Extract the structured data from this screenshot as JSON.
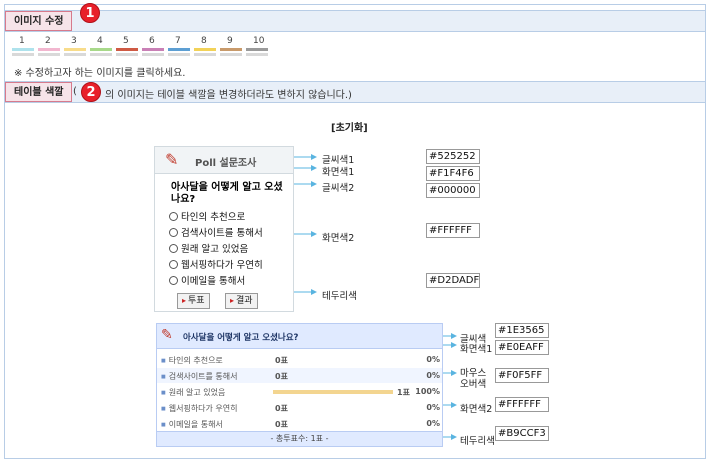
{
  "section1": {
    "title": "이미지 수정",
    "badge": "1",
    "note": "※ 수정하고자 하는 이미지를 클릭하세요."
  },
  "swatches": [
    {
      "num": "1",
      "c": "#aee2ec"
    },
    {
      "num": "2",
      "c": "#f2b6cf"
    },
    {
      "num": "3",
      "c": "#f8dc8a"
    },
    {
      "num": "4",
      "c": "#a8d98a"
    },
    {
      "num": "5",
      "c": "#cf5a44"
    },
    {
      "num": "6",
      "c": "#c980b6"
    },
    {
      "num": "7",
      "c": "#5d9fd3"
    },
    {
      "num": "8",
      "c": "#f2d258"
    },
    {
      "num": "9",
      "c": "#c89a6b"
    },
    {
      "num": "10",
      "c": "#9a9a9a"
    }
  ],
  "section2": {
    "title": "테이블 색깔",
    "badge": "2",
    "note_prefix": "(",
    "note": "의 이미지는 테이블 색깔을 변경하더라도 변하지 않습니다.)"
  },
  "init_label": "[초기화]",
  "poll": {
    "title": "Poll 설문조사",
    "question": "아사달을 어떻게 알고 오셨나요?",
    "options": [
      "타인의 추천으로",
      "검색사이트를 통해서",
      "원래 알고 있었음",
      "웹서핑하다가 우연히",
      "이메일을 통해서"
    ],
    "vote_btn": "투표",
    "result_btn": "결과"
  },
  "labels1": {
    "text_color": "글씨색1",
    "bg_color": "화면색1",
    "text_color2": "글씨색2",
    "bg_color2": "화면색2",
    "border": "테두리색"
  },
  "hex1": {
    "a": "#525252",
    "b": "#F1F4F6",
    "c": "#000000",
    "d": "#FFFFFF",
    "e": "#D2DADF"
  },
  "result": {
    "title": "아사달을 어떻게 알고 오셨나요?",
    "rows": [
      {
        "name": "타인의 추천으로",
        "count": "0표",
        "pct": "0%"
      },
      {
        "name": "검색사이트를 통해서",
        "count": "0표",
        "pct": "0%"
      },
      {
        "name": "원래 알고 있었음",
        "count": "1표",
        "pct": "100%"
      },
      {
        "name": "웹서핑하다가 우연히",
        "count": "0표",
        "pct": "0%"
      },
      {
        "name": "이메일을 통해서",
        "count": "0표",
        "pct": "0%"
      }
    ],
    "footer": "- 총투표수: 1표 -"
  },
  "labels2": {
    "text": "글씨색",
    "bg1": "화면색1",
    "mouse_l1": "마우스",
    "mouse_l2": "오버색",
    "bg2": "화면색2",
    "border": "테두리색"
  },
  "hex2": {
    "a": "#1E3565",
    "b": "#E0EAFF",
    "c": "#F0F5FF",
    "d": "#FFFFFF",
    "e": "#B9CCF3"
  }
}
